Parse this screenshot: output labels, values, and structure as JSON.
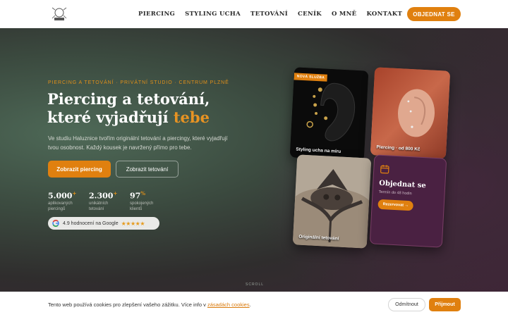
{
  "nav": {
    "items": [
      "PIERCING",
      "STYLING UCHA",
      "TETOVÁNÍ",
      "CENÍK",
      "O MNĚ",
      "KONTAKT"
    ],
    "cta": "OBJEDNAT SE"
  },
  "hero": {
    "eyebrow": "PIERCING A TETOVÁNÍ · PRIVÁTNÍ STUDIO · CENTRUM PLZNĚ",
    "title_line1": "Piercing a tetování,",
    "title_line2_prefix": "které vyjadřují ",
    "title_accent": "tebe",
    "lead": "Ve studiu Haluznice tvořím originální tetování a piercingy, které vyjadřují tvou osobnost. Každý kousek je navržený přímo pro tebe.",
    "btn_primary": "Zobrazit piercing",
    "btn_secondary": "Zobrazit tetování",
    "stats": [
      {
        "num": "5.000",
        "suffix": "+",
        "label": "aplikovaných piercingů"
      },
      {
        "num": "2.300",
        "suffix": "+",
        "label": "unikátních tetování"
      },
      {
        "num": "97",
        "suffix": "%",
        "label": "spokojených klientů"
      }
    ],
    "google": {
      "text": "4.9 hodnocení na Google",
      "stars": "★★★★★",
      "rating": 4.9
    }
  },
  "cards": {
    "c1_badge": "NOVÁ SLUŽBA",
    "c1_caption": "Styling ucha na míru",
    "c2_caption": "Piercing · od 800 Kč",
    "c3_caption": "Originální tetování",
    "c4_title": "Objednat se",
    "c4_sub": "Termín do 48 hodin",
    "c4_button": "Rezervovat →"
  },
  "scroll": "SCROLL",
  "cookie": {
    "text_before": "Tento web používá cookies pro zlepšení vašeho zážitku. Více info v ",
    "link": "zásadách cookies",
    "text_after": ".",
    "decline": "Odmítnout",
    "accept": "Přijmout"
  },
  "colors": {
    "accent": "#e0800f",
    "cookie_link": "#d97a0c"
  }
}
